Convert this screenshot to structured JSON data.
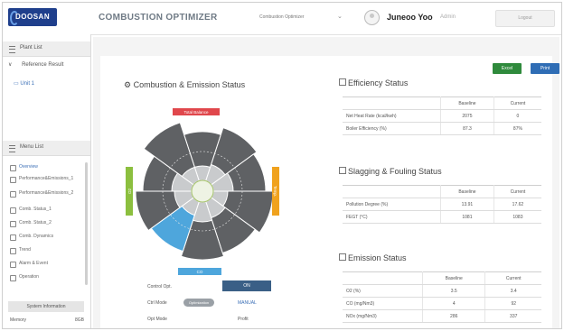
{
  "header": {
    "logo": "DOOSAN",
    "app_title": "COMBUSTION OPTIMIZER",
    "dropdown_value": "Combustion Optimizer",
    "user_name": "Juneoo Yoo",
    "user_role": "Admin",
    "logout_label": "Logout"
  },
  "sidebar": {
    "plant_list_label": "Plant List",
    "tree_root": "Reference Result",
    "unit_label": "Unit 1",
    "menu_list_label": "Menu List",
    "menu_items": [
      {
        "label": "Overview",
        "active": true
      },
      {
        "label": "Performance&Emissions_1",
        "active": false
      },
      {
        "label": "Performance&Emissions_2",
        "active": false
      },
      {
        "label": "Comb. Status_1",
        "active": false
      },
      {
        "label": "Comb. Status_2",
        "active": false
      },
      {
        "label": "Comb. Dynamics",
        "active": false
      },
      {
        "label": "Trend",
        "active": false
      },
      {
        "label": "Alarm & Event",
        "active": false
      },
      {
        "label": "Operation",
        "active": false
      }
    ],
    "system_info_label": "System Information",
    "system_row": {
      "label": "Memory",
      "value": "8GB"
    }
  },
  "toolbar": {
    "excel_label": "Excel",
    "print_label": "Print"
  },
  "combustion": {
    "title": "Combustion & Emission Status",
    "label_top": "Total Balance",
    "label_left": "O2",
    "label_right": "Temp.",
    "label_bottom": "CO",
    "colors": {
      "top": "#e0474c",
      "left": "#8cbf3f",
      "right": "#f0a21e",
      "bottom": "#4ea6dc",
      "highlight": "#4ea6dc",
      "sector": "#5f6164"
    }
  },
  "efficiency": {
    "title": "Efficiency Status",
    "headers": [
      "",
      "Baseline",
      "Current"
    ],
    "rows": [
      [
        "Net Heat Rate (kcal/kwh)",
        "2075",
        "0"
      ],
      [
        "Boiler Efficiency (%)",
        "87.3",
        "87%"
      ]
    ]
  },
  "slagging": {
    "title": "Slagging & Fouling Status",
    "headers": [
      "",
      "Baseline",
      "Current"
    ],
    "rows": [
      [
        "Pollution Degree (%)",
        "13.91",
        "17.62"
      ],
      [
        "FEGT (°C)",
        "1081",
        "1083"
      ]
    ]
  },
  "emission": {
    "title": "Emission Status",
    "headers": [
      "",
      "Baseline",
      "Current"
    ],
    "rows": [
      [
        "O2 (%)",
        "3.5",
        "3.4"
      ],
      [
        "CO (mg/Nm3)",
        "4",
        "92"
      ],
      [
        "NOx (mg/Nm3)",
        "286",
        "337"
      ]
    ]
  },
  "controls": {
    "control_opt_label": "Control Opt.",
    "control_opt_button": "ON",
    "ctrl_mode_label": "Ctrl Mode",
    "ctrl_mode_pill": "Optimization",
    "ctrl_mode_value": "MANUAL",
    "opt_mode_label": "Opt Mode",
    "opt_mode_value": "Profit"
  }
}
